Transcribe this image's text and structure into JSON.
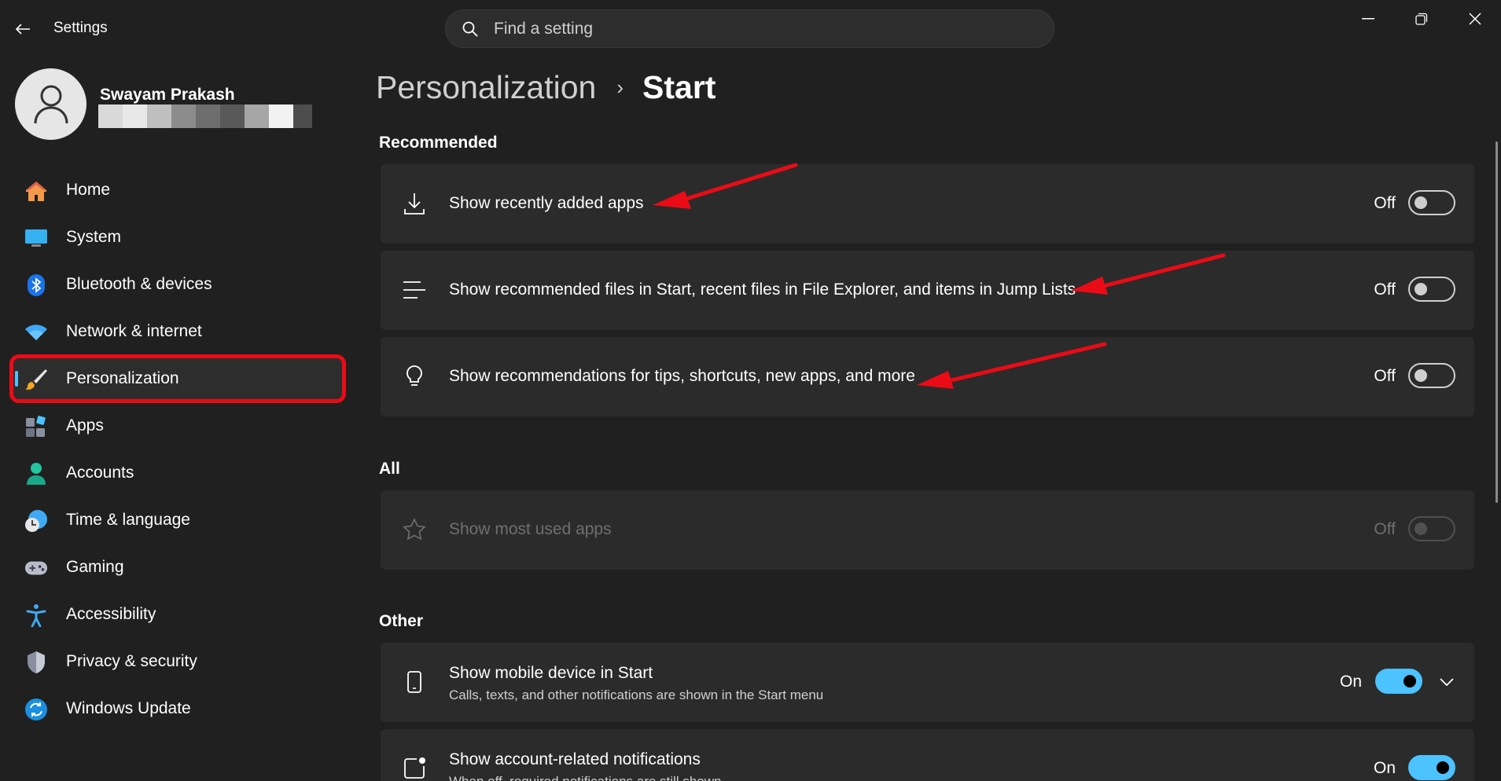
{
  "window": {
    "title": "Settings",
    "controls": [
      "minimize",
      "restore",
      "close"
    ]
  },
  "search": {
    "placeholder": "Find a setting",
    "value": ""
  },
  "user": {
    "name": "Swayam Prakash"
  },
  "sidebar": {
    "items": [
      {
        "label": "Home",
        "icon": "home-icon",
        "selected": false
      },
      {
        "label": "System",
        "icon": "monitor-icon",
        "selected": false
      },
      {
        "label": "Bluetooth & devices",
        "icon": "bluetooth-icon",
        "selected": false
      },
      {
        "label": "Network & internet",
        "icon": "wifi-icon",
        "selected": false
      },
      {
        "label": "Personalization",
        "icon": "brush-icon",
        "selected": true
      },
      {
        "label": "Apps",
        "icon": "apps-icon",
        "selected": false
      },
      {
        "label": "Accounts",
        "icon": "person-icon",
        "selected": false
      },
      {
        "label": "Time & language",
        "icon": "clock-globe-icon",
        "selected": false
      },
      {
        "label": "Gaming",
        "icon": "gamepad-icon",
        "selected": false
      },
      {
        "label": "Accessibility",
        "icon": "accessibility-icon",
        "selected": false
      },
      {
        "label": "Privacy & security",
        "icon": "shield-icon",
        "selected": false
      },
      {
        "label": "Windows Update",
        "icon": "refresh-icon",
        "selected": false
      }
    ]
  },
  "breadcrumb": {
    "parent": "Personalization",
    "separator": "›",
    "current": "Start"
  },
  "sections": {
    "recommended": {
      "title": "Recommended",
      "items": [
        {
          "label": "Show recently added apps",
          "icon": "download-icon",
          "state": "Off"
        },
        {
          "label": "Show recommended files in Start, recent files in File Explorer, and items in Jump Lists",
          "icon": "list-icon",
          "state": "Off"
        },
        {
          "label": "Show recommendations for tips, shortcuts, new apps, and more",
          "icon": "lightbulb-icon",
          "state": "Off"
        }
      ]
    },
    "all": {
      "title": "All",
      "items": [
        {
          "label": "Show most used apps",
          "icon": "star-icon",
          "state": "Off",
          "disabled": true
        }
      ]
    },
    "other": {
      "title": "Other",
      "items": [
        {
          "label": "Show mobile device in Start",
          "sublabel": "Calls, texts, and other notifications are shown in the Start menu",
          "icon": "phone-icon",
          "state": "On"
        },
        {
          "label": "Show account-related notifications",
          "sublabel": "When off, required notifications are still shown",
          "icon": "notification-icon",
          "state": "On"
        }
      ]
    }
  },
  "colors": {
    "background": "#202020",
    "card": "#2b2b2b",
    "accent": "#4cc2ff",
    "annotation": "#ea0b16"
  }
}
